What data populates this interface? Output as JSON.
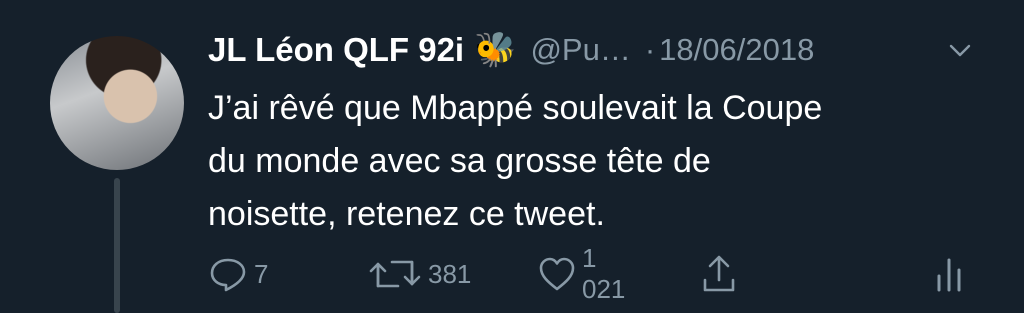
{
  "author": {
    "display_name": "JL Léon QLF 92i",
    "name_emoji": "🐝",
    "handle": "@Pu…",
    "separator": "·",
    "date": "18/06/2018"
  },
  "tweet": {
    "text": "J’ai rêvé que Mbappé soulevait la Coupe\ndu monde avec sa grosse tête de\nnoisette, retenez ce tweet."
  },
  "actions": {
    "reply_count": "7",
    "retweet_count": "381",
    "like_count": "1 021"
  },
  "colors": {
    "background": "#15202b",
    "text": "#ffffff",
    "muted": "#8899a6",
    "thread_line": "#38444d"
  },
  "icons": [
    "reply-icon",
    "retweet-icon",
    "like-icon",
    "share-icon",
    "analytics-icon",
    "chevron-down-icon"
  ]
}
